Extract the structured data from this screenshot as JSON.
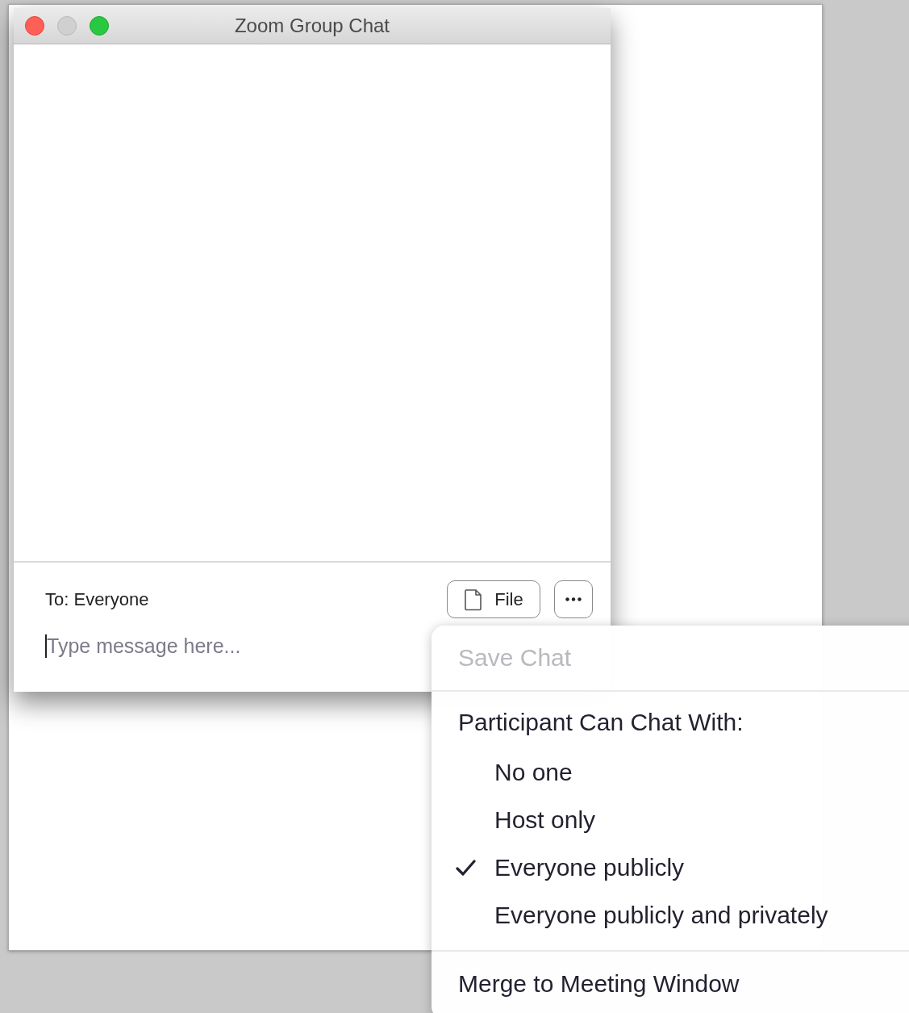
{
  "window": {
    "title": "Zoom Group Chat",
    "controls": [
      {
        "kind": "close",
        "disabled": false
      },
      {
        "kind": "minimize",
        "disabled": true
      },
      {
        "kind": "zoom",
        "disabled": false
      }
    ]
  },
  "composer": {
    "recipient": "To: Everyone",
    "placeholder": "Type message here...",
    "buttons": [
      {
        "kind": "file",
        "label": "File"
      },
      {
        "kind": "more"
      }
    ]
  },
  "menu": {
    "items": [
      {
        "kind": "action",
        "label": "Save Chat",
        "disabled": true
      },
      {
        "kind": "separator"
      },
      {
        "kind": "header",
        "label": "Participant Can Chat With:"
      },
      {
        "kind": "option",
        "label": "No one",
        "selected": false
      },
      {
        "kind": "option",
        "label": "Host only",
        "selected": false
      },
      {
        "kind": "option",
        "label": "Everyone publicly",
        "selected": true
      },
      {
        "kind": "option",
        "label": "Everyone publicly and privately",
        "selected": false
      },
      {
        "kind": "separator"
      },
      {
        "kind": "action",
        "label": "Merge to Meeting Window",
        "disabled": false
      }
    ]
  }
}
